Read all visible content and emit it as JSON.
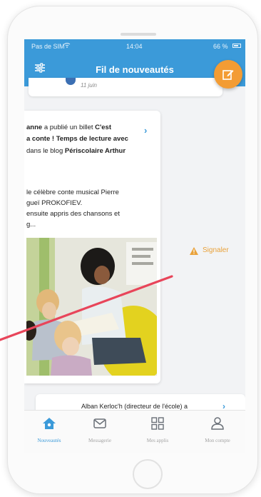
{
  "status_bar": {
    "carrier": "Pas de SIM",
    "time": "14:04",
    "battery": "66 %"
  },
  "header": {
    "title": "Fil de nouveautés"
  },
  "top_card": {
    "date": "11 juin"
  },
  "post": {
    "line1_author": "anne",
    "line1_text": " a publié un billet ",
    "line1_bold": "C'est",
    "line2": "a conte ! Temps de lecture avec",
    "line3_text": "dans le blog ",
    "line3_bold": "Périscolaire Arthur",
    "excerpt": [
      "le célèbre conte musical Pierre",
      "gueï PROKOFIEV.",
      "ensuite appris des chansons et",
      "g..."
    ]
  },
  "report": {
    "label": "Signaler"
  },
  "next_post": {
    "text": "Alban Kerloc'h (directeur de l'école) a"
  },
  "tabs": [
    {
      "label": "Nouveautés",
      "icon": "home-icon",
      "active": true
    },
    {
      "label": "Messagerie",
      "icon": "envelope-icon",
      "active": false
    },
    {
      "label": "Mes applis",
      "icon": "apps-grid-icon",
      "active": false
    },
    {
      "label": "Mon compte",
      "icon": "user-icon",
      "active": false
    }
  ],
  "colors": {
    "accent": "#3b9ad9",
    "compose": "#f39c34",
    "pointer": "#e8455a",
    "report": "#e9a23b"
  }
}
